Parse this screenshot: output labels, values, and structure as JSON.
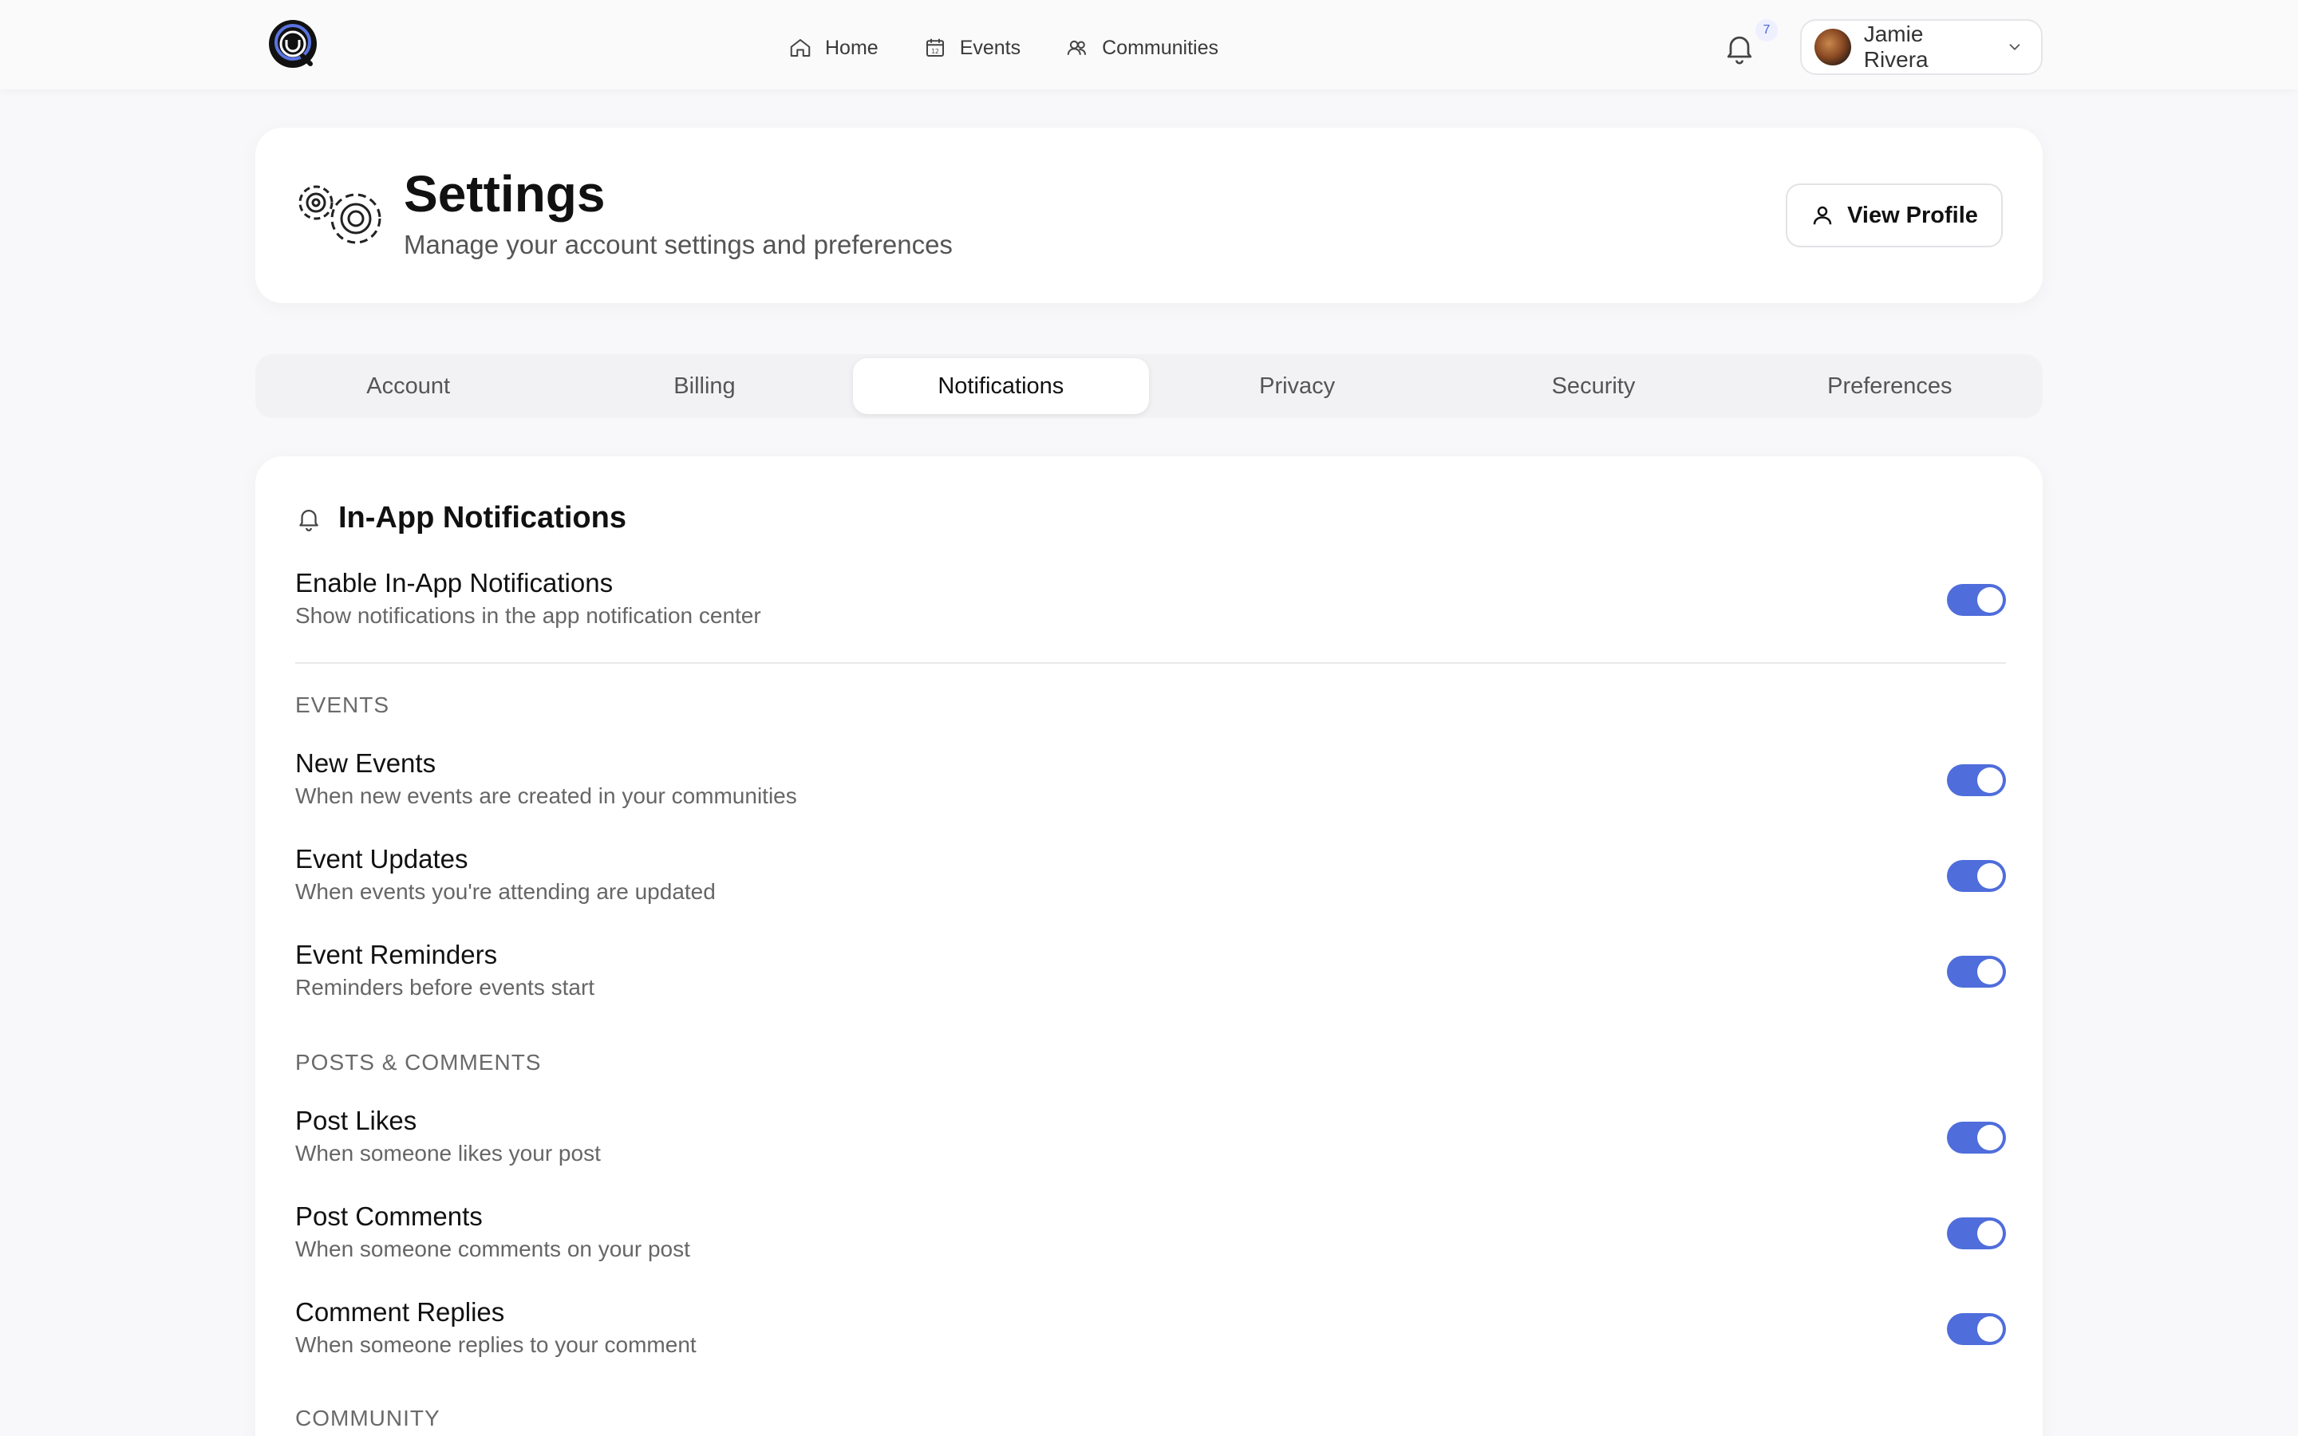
{
  "nav": {
    "items": [
      {
        "label": "Home",
        "icon": "home-icon"
      },
      {
        "label": "Events",
        "icon": "calendar-icon"
      },
      {
        "label": "Communities",
        "icon": "users-icon"
      }
    ],
    "notification_count": "7",
    "user_name": "Jamie Rivera"
  },
  "header": {
    "title": "Settings",
    "subtitle": "Manage your account settings and preferences",
    "view_profile_label": "View Profile"
  },
  "tabs": [
    {
      "label": "Account",
      "active": false
    },
    {
      "label": "Billing",
      "active": false
    },
    {
      "label": "Notifications",
      "active": true
    },
    {
      "label": "Privacy",
      "active": false
    },
    {
      "label": "Security",
      "active": false
    },
    {
      "label": "Preferences",
      "active": false
    }
  ],
  "notifications": {
    "title": "In-App Notifications",
    "master": {
      "title": "Enable In-App Notifications",
      "desc": "Show notifications in the app notification center",
      "enabled": true
    },
    "sections": [
      {
        "label": "EVENTS",
        "items": [
          {
            "title": "New Events",
            "desc": "When new events are created in your communities",
            "enabled": true
          },
          {
            "title": "Event Updates",
            "desc": "When events you're attending are updated",
            "enabled": true
          },
          {
            "title": "Event Reminders",
            "desc": "Reminders before events start",
            "enabled": true
          }
        ]
      },
      {
        "label": "POSTS & COMMENTS",
        "items": [
          {
            "title": "Post Likes",
            "desc": "When someone likes your post",
            "enabled": true
          },
          {
            "title": "Post Comments",
            "desc": "When someone comments on your post",
            "enabled": true
          },
          {
            "title": "Comment Replies",
            "desc": "When someone replies to your comment",
            "enabled": true
          }
        ]
      },
      {
        "label": "COMMUNITY",
        "items": []
      }
    ]
  },
  "colors": {
    "accent": "#4f6ddb",
    "background": "#f8f8fa",
    "card": "#ffffff"
  }
}
